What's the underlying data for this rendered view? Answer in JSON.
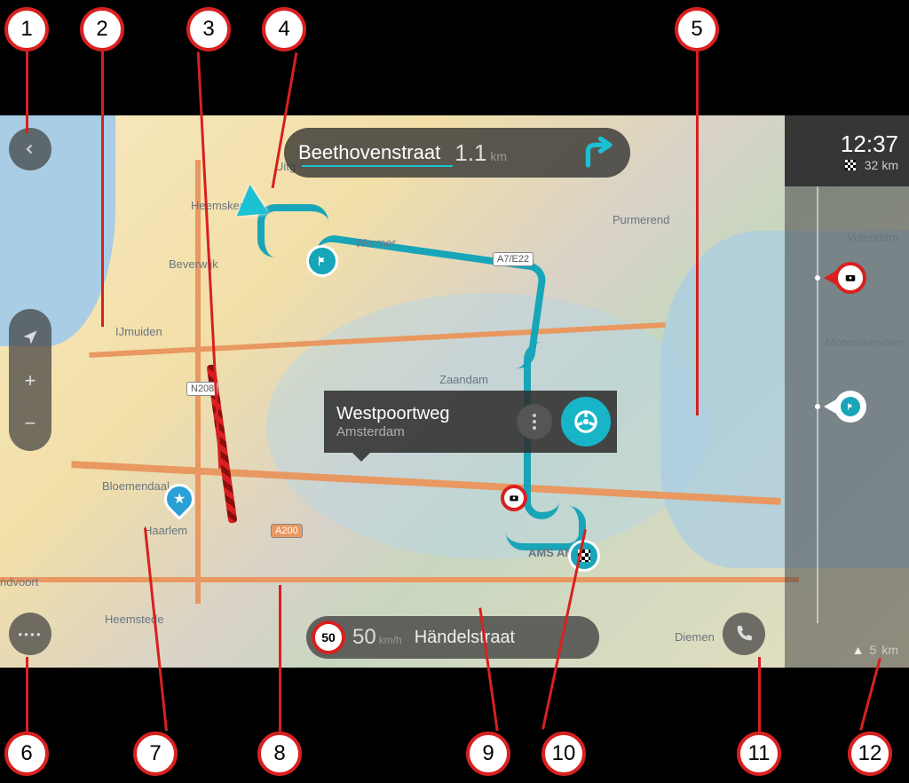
{
  "next_instruction": {
    "street": "Beethovenstraat",
    "distance_value": "1.1",
    "distance_unit": "km"
  },
  "selected_location": {
    "name": "Westpoortweg",
    "city": "Amsterdam"
  },
  "bottom_bar": {
    "speed_limit": "50",
    "current_speed": "50",
    "speed_unit": "km/h",
    "street": "Händelstraat"
  },
  "route_bar": {
    "arrival_time": "12:37",
    "remaining_value": "32",
    "remaining_unit": "km",
    "scale_value": "5",
    "scale_unit": "km"
  },
  "map_labels": {
    "heemskerk": "Heemskerk",
    "beverwijk": "Beverwijk",
    "ijmuiden": "IJmuiden",
    "bloemendaal": "Bloemendaal",
    "haarlem": "Haarlem",
    "heemstede": "Heemstede",
    "ndvoort": "ndvoort",
    "wormer": "Wormer",
    "zaandam": "Zaandam",
    "amsterdam": "AMS        AM",
    "diemen": "Diemen",
    "purmerend": "Purmerend",
    "volendam": "Volendam",
    "monnickendam": "Monnickendam",
    "uitg": "Uitg"
  },
  "road_badges": {
    "n208": "N208",
    "a200": "A200",
    "a7e22": "A7/E22"
  },
  "callouts": [
    "1",
    "2",
    "3",
    "4",
    "5",
    "6",
    "7",
    "8",
    "9",
    "10",
    "11",
    "12"
  ]
}
